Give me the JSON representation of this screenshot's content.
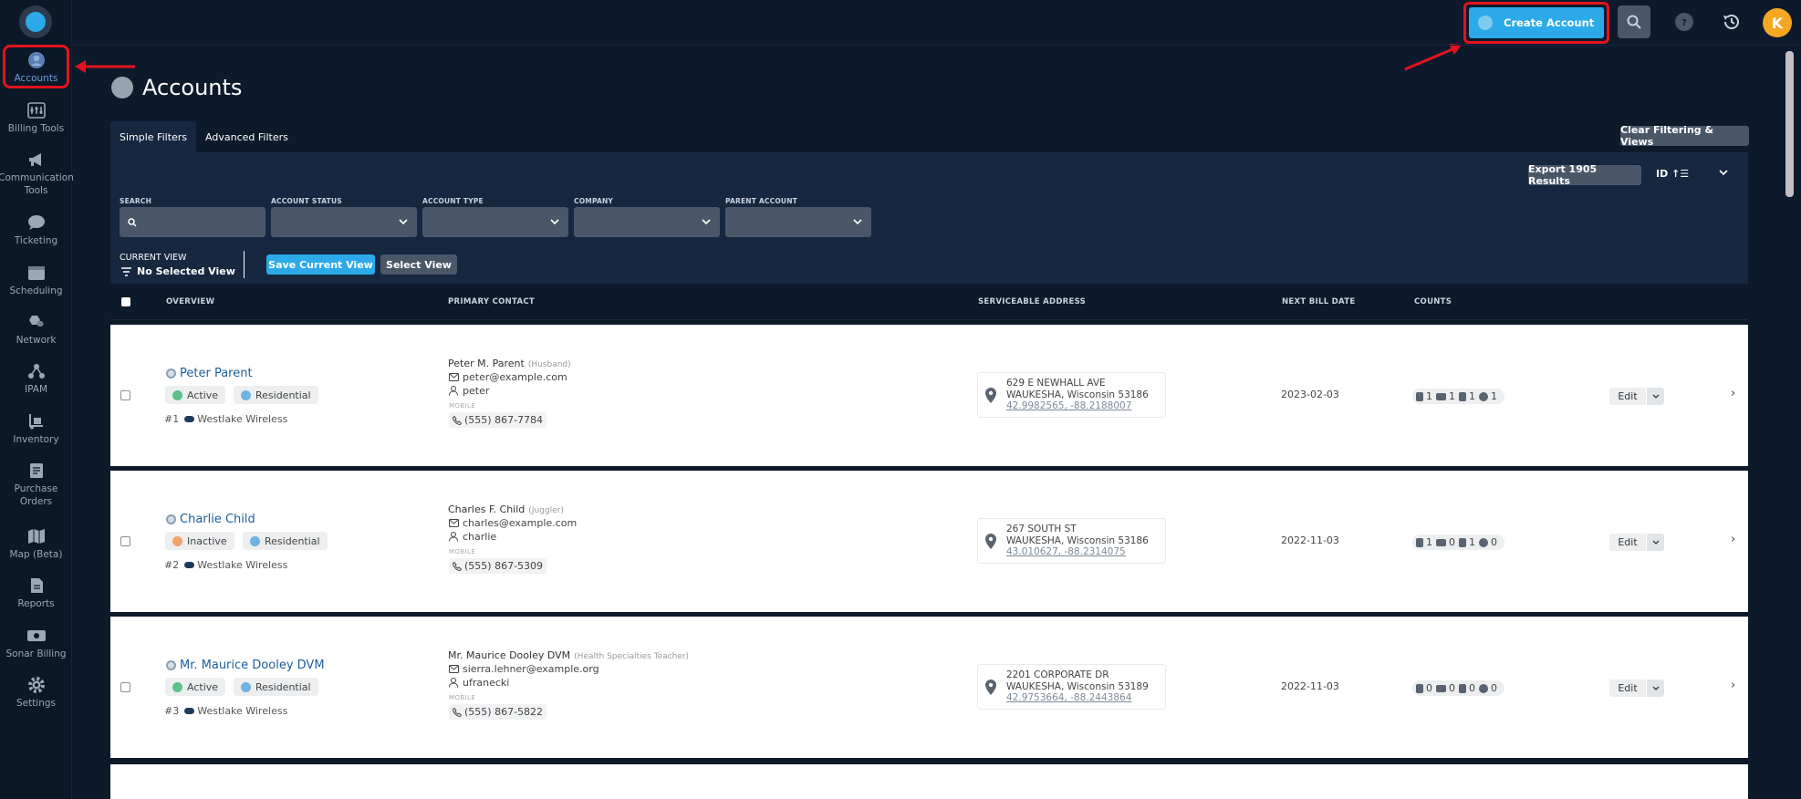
{
  "sidebar": {
    "items": [
      {
        "label": "Accounts"
      },
      {
        "label": "Billing Tools"
      },
      {
        "label": "Communication\nTools"
      },
      {
        "label": "Ticketing"
      },
      {
        "label": "Scheduling"
      },
      {
        "label": "Network"
      },
      {
        "label": "IPAM"
      },
      {
        "label": "Inventory"
      },
      {
        "label": "Purchase\nOrders"
      },
      {
        "label": "Map (Beta)"
      },
      {
        "label": "Reports"
      },
      {
        "label": "Sonar Billing"
      },
      {
        "label": "Settings"
      }
    ]
  },
  "topbar": {
    "create_label": "Create Account",
    "avatar_initial": "K",
    "icons": [
      "search-icon",
      "help-icon",
      "history-icon"
    ]
  },
  "page": {
    "title": "Accounts"
  },
  "filters": {
    "tabs": [
      "Simple Filters",
      "Advanced Filters"
    ],
    "clear_label": "Clear Filtering & Views",
    "export_label": "Export 1905 Results",
    "sort_label": "ID ↑☰",
    "fields": [
      {
        "label": "SEARCH"
      },
      {
        "label": "ACCOUNT STATUS"
      },
      {
        "label": "ACCOUNT TYPE"
      },
      {
        "label": "COMPANY"
      },
      {
        "label": "PARENT ACCOUNT"
      }
    ],
    "current_view_label": "CURRENT VIEW",
    "current_view_value": "No Selected View",
    "save_view_label": "Save Current View",
    "select_view_label": "Select View"
  },
  "table": {
    "columns": [
      "OVERVIEW",
      "PRIMARY CONTACT",
      "SERVICEABLE ADDRESS",
      "NEXT BILL DATE",
      "COUNTS"
    ],
    "rows": [
      {
        "name": "Peter Parent",
        "status": "Active",
        "status_color": "#5cc08a",
        "type": "Residential",
        "id": "#1",
        "company": "Westlake Wireless",
        "contact_name": "Peter M. Parent",
        "contact_role": "(Husband)",
        "email": "peter@example.com",
        "username": "peter",
        "mobile_label": "MOBILE",
        "phone": "(555) 867-7784",
        "addr1": "629 E NEWHALL AVE",
        "addr2": "WAUKESHA, Wisconsin 53186",
        "coords": "42.9982565, -88.2188007",
        "bill_date": "2023-02-03",
        "counts": [
          "1",
          "1",
          "1",
          "1"
        ],
        "edit_label": "Edit"
      },
      {
        "name": "Charlie Child",
        "status": "Inactive",
        "status_color": "#f0a36a",
        "type": "Residential",
        "id": "#2",
        "company": "Westlake Wireless",
        "contact_name": "Charles F. Child",
        "contact_role": "(Juggler)",
        "email": "charles@example.com",
        "username": "charlie",
        "mobile_label": "MOBILE",
        "phone": "(555) 867-5309",
        "addr1": "267 SOUTH ST",
        "addr2": "WAUKESHA, Wisconsin 53186",
        "coords": "43.010627, -88.2314075",
        "bill_date": "2022-11-03",
        "counts": [
          "1",
          "0",
          "1",
          "0"
        ],
        "edit_label": "Edit"
      },
      {
        "name": "Mr. Maurice Dooley DVM",
        "status": "Active",
        "status_color": "#5cc08a",
        "type": "Residential",
        "id": "#3",
        "company": "Westlake Wireless",
        "contact_name": "Mr. Maurice Dooley DVM",
        "contact_role": "(Health Specialties Teacher)",
        "email": "sierra.lehner@example.org",
        "username": "ufranecki",
        "mobile_label": "MOBILE",
        "phone": "(555) 867-5822",
        "addr1": "2201 CORPORATE DR",
        "addr2": "WAUKESHA, Wisconsin 53189",
        "coords": "42.9753664, -88.2443864",
        "bill_date": "2022-11-03",
        "counts": [
          "0",
          "0",
          "0",
          "0"
        ],
        "edit_label": "Edit"
      }
    ]
  },
  "colors": {
    "accent": "#2ca9e8",
    "highlight": "#e2131e",
    "background": "#0d1a2b",
    "panel": "#16283f",
    "type_dot": "#6fb3e0"
  }
}
